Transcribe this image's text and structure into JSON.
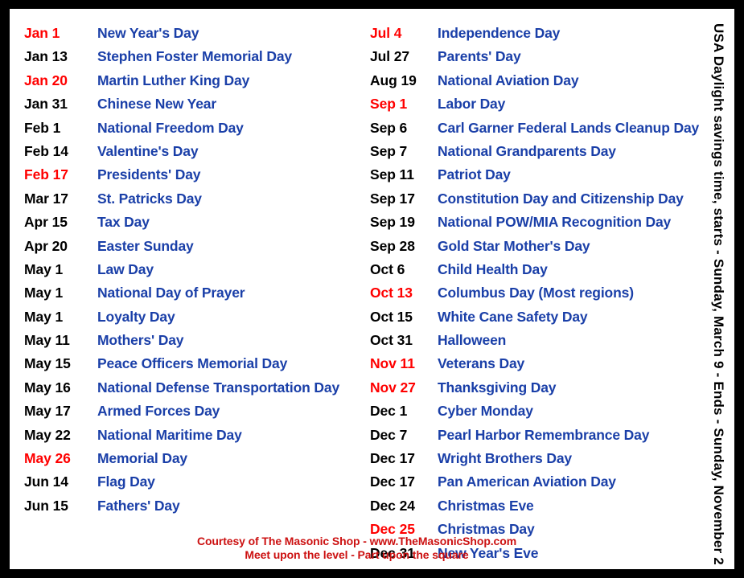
{
  "colors": {
    "frame": "#000000",
    "sheet_background": "#ffffff",
    "holiday_name": "#1a3fa8",
    "federal_holiday_date": "#ff0000",
    "regular_date": "#000000",
    "footer": "#cc1111"
  },
  "dst_note": {
    "text": "USA Daylight savings time, starts - Sunday, March 9  - Ends - Sunday, November 2"
  },
  "footer": {
    "line1": "Courtesy of The Masonic Shop - www.TheMasonicShop.com",
    "line2": "Meet upon the level - Part upon the square"
  },
  "left_column": [
    {
      "date": "Jan 1",
      "name": "New Year's Day",
      "highlight": true
    },
    {
      "date": "Jan 13",
      "name": "Stephen Foster Memorial Day",
      "highlight": false
    },
    {
      "date": "Jan 20",
      "name": "Martin Luther King Day",
      "highlight": true
    },
    {
      "date": "Jan 31",
      "name": "Chinese New Year",
      "highlight": false
    },
    {
      "date": "Feb 1",
      "name": "National Freedom Day",
      "highlight": false
    },
    {
      "date": "Feb 14",
      "name": "Valentine's Day",
      "highlight": false
    },
    {
      "date": "Feb 17",
      "name": "Presidents' Day",
      "highlight": true
    },
    {
      "date": "Mar 17",
      "name": "St. Patricks Day",
      "highlight": false
    },
    {
      "date": "Apr 15",
      "name": "Tax Day",
      "highlight": false
    },
    {
      "date": "Apr 20",
      "name": "Easter Sunday",
      "highlight": false
    },
    {
      "date": "May 1",
      "name": "Law Day",
      "highlight": false
    },
    {
      "date": "May 1",
      "name": "National Day of Prayer",
      "highlight": false
    },
    {
      "date": "May 1",
      "name": "Loyalty Day",
      "highlight": false
    },
    {
      "date": "May 11",
      "name": "Mothers' Day",
      "highlight": false
    },
    {
      "date": "May 15",
      "name": "Peace Officers Memorial Day",
      "highlight": false
    },
    {
      "date": "May 16",
      "name": "National Defense Transportation Day",
      "highlight": false
    },
    {
      "date": "May 17",
      "name": "Armed Forces Day",
      "highlight": false
    },
    {
      "date": "May 22",
      "name": "National Maritime Day",
      "highlight": false
    },
    {
      "date": "May 26",
      "name": "Memorial Day",
      "highlight": true
    },
    {
      "date": "Jun 14",
      "name": "Flag Day",
      "highlight": false
    },
    {
      "date": "Jun 15",
      "name": "Fathers' Day",
      "highlight": false
    }
  ],
  "right_column": [
    {
      "date": "Jul 4",
      "name": "Independence Day",
      "highlight": true
    },
    {
      "date": "Jul 27",
      "name": "Parents' Day",
      "highlight": false
    },
    {
      "date": "Aug 19",
      "name": "National Aviation Day",
      "highlight": false
    },
    {
      "date": "Sep 1",
      "name": "Labor Day",
      "highlight": true
    },
    {
      "date": "Sep 6",
      "name": "Carl Garner Federal Lands Cleanup Day",
      "highlight": false
    },
    {
      "date": "Sep 7",
      "name": "National Grandparents Day",
      "highlight": false
    },
    {
      "date": "Sep 11",
      "name": "Patriot Day",
      "highlight": false
    },
    {
      "date": "Sep 17",
      "name": "Constitution Day and Citizenship Day",
      "highlight": false
    },
    {
      "date": "Sep 19",
      "name": "National POW/MIA Recognition Day",
      "highlight": false
    },
    {
      "date": "Sep 28",
      "name": "Gold Star Mother's Day",
      "highlight": false
    },
    {
      "date": "Oct 6",
      "name": "Child Health Day",
      "highlight": false
    },
    {
      "date": "Oct 13",
      "name": "Columbus Day (Most regions)",
      "highlight": true
    },
    {
      "date": "Oct 15",
      "name": "White Cane Safety Day",
      "highlight": false
    },
    {
      "date": "Oct 31",
      "name": "Halloween",
      "highlight": false
    },
    {
      "date": "Nov 11",
      "name": "Veterans Day",
      "highlight": true
    },
    {
      "date": "Nov 27",
      "name": "Thanksgiving Day",
      "highlight": true
    },
    {
      "date": "Dec 1",
      "name": "Cyber Monday",
      "highlight": false
    },
    {
      "date": "Dec 7",
      "name": "Pearl Harbor Remembrance Day",
      "highlight": false
    },
    {
      "date": "Dec 17",
      "name": "Wright Brothers Day",
      "highlight": false
    },
    {
      "date": "Dec 17",
      "name": "Pan American Aviation Day",
      "highlight": false
    },
    {
      "date": "Dec 24",
      "name": "Christmas Eve",
      "highlight": false
    },
    {
      "date": "Dec 25",
      "name": "Christmas Day",
      "highlight": true
    },
    {
      "date": "Dec 31",
      "name": "New Year's Eve",
      "highlight": false
    }
  ]
}
